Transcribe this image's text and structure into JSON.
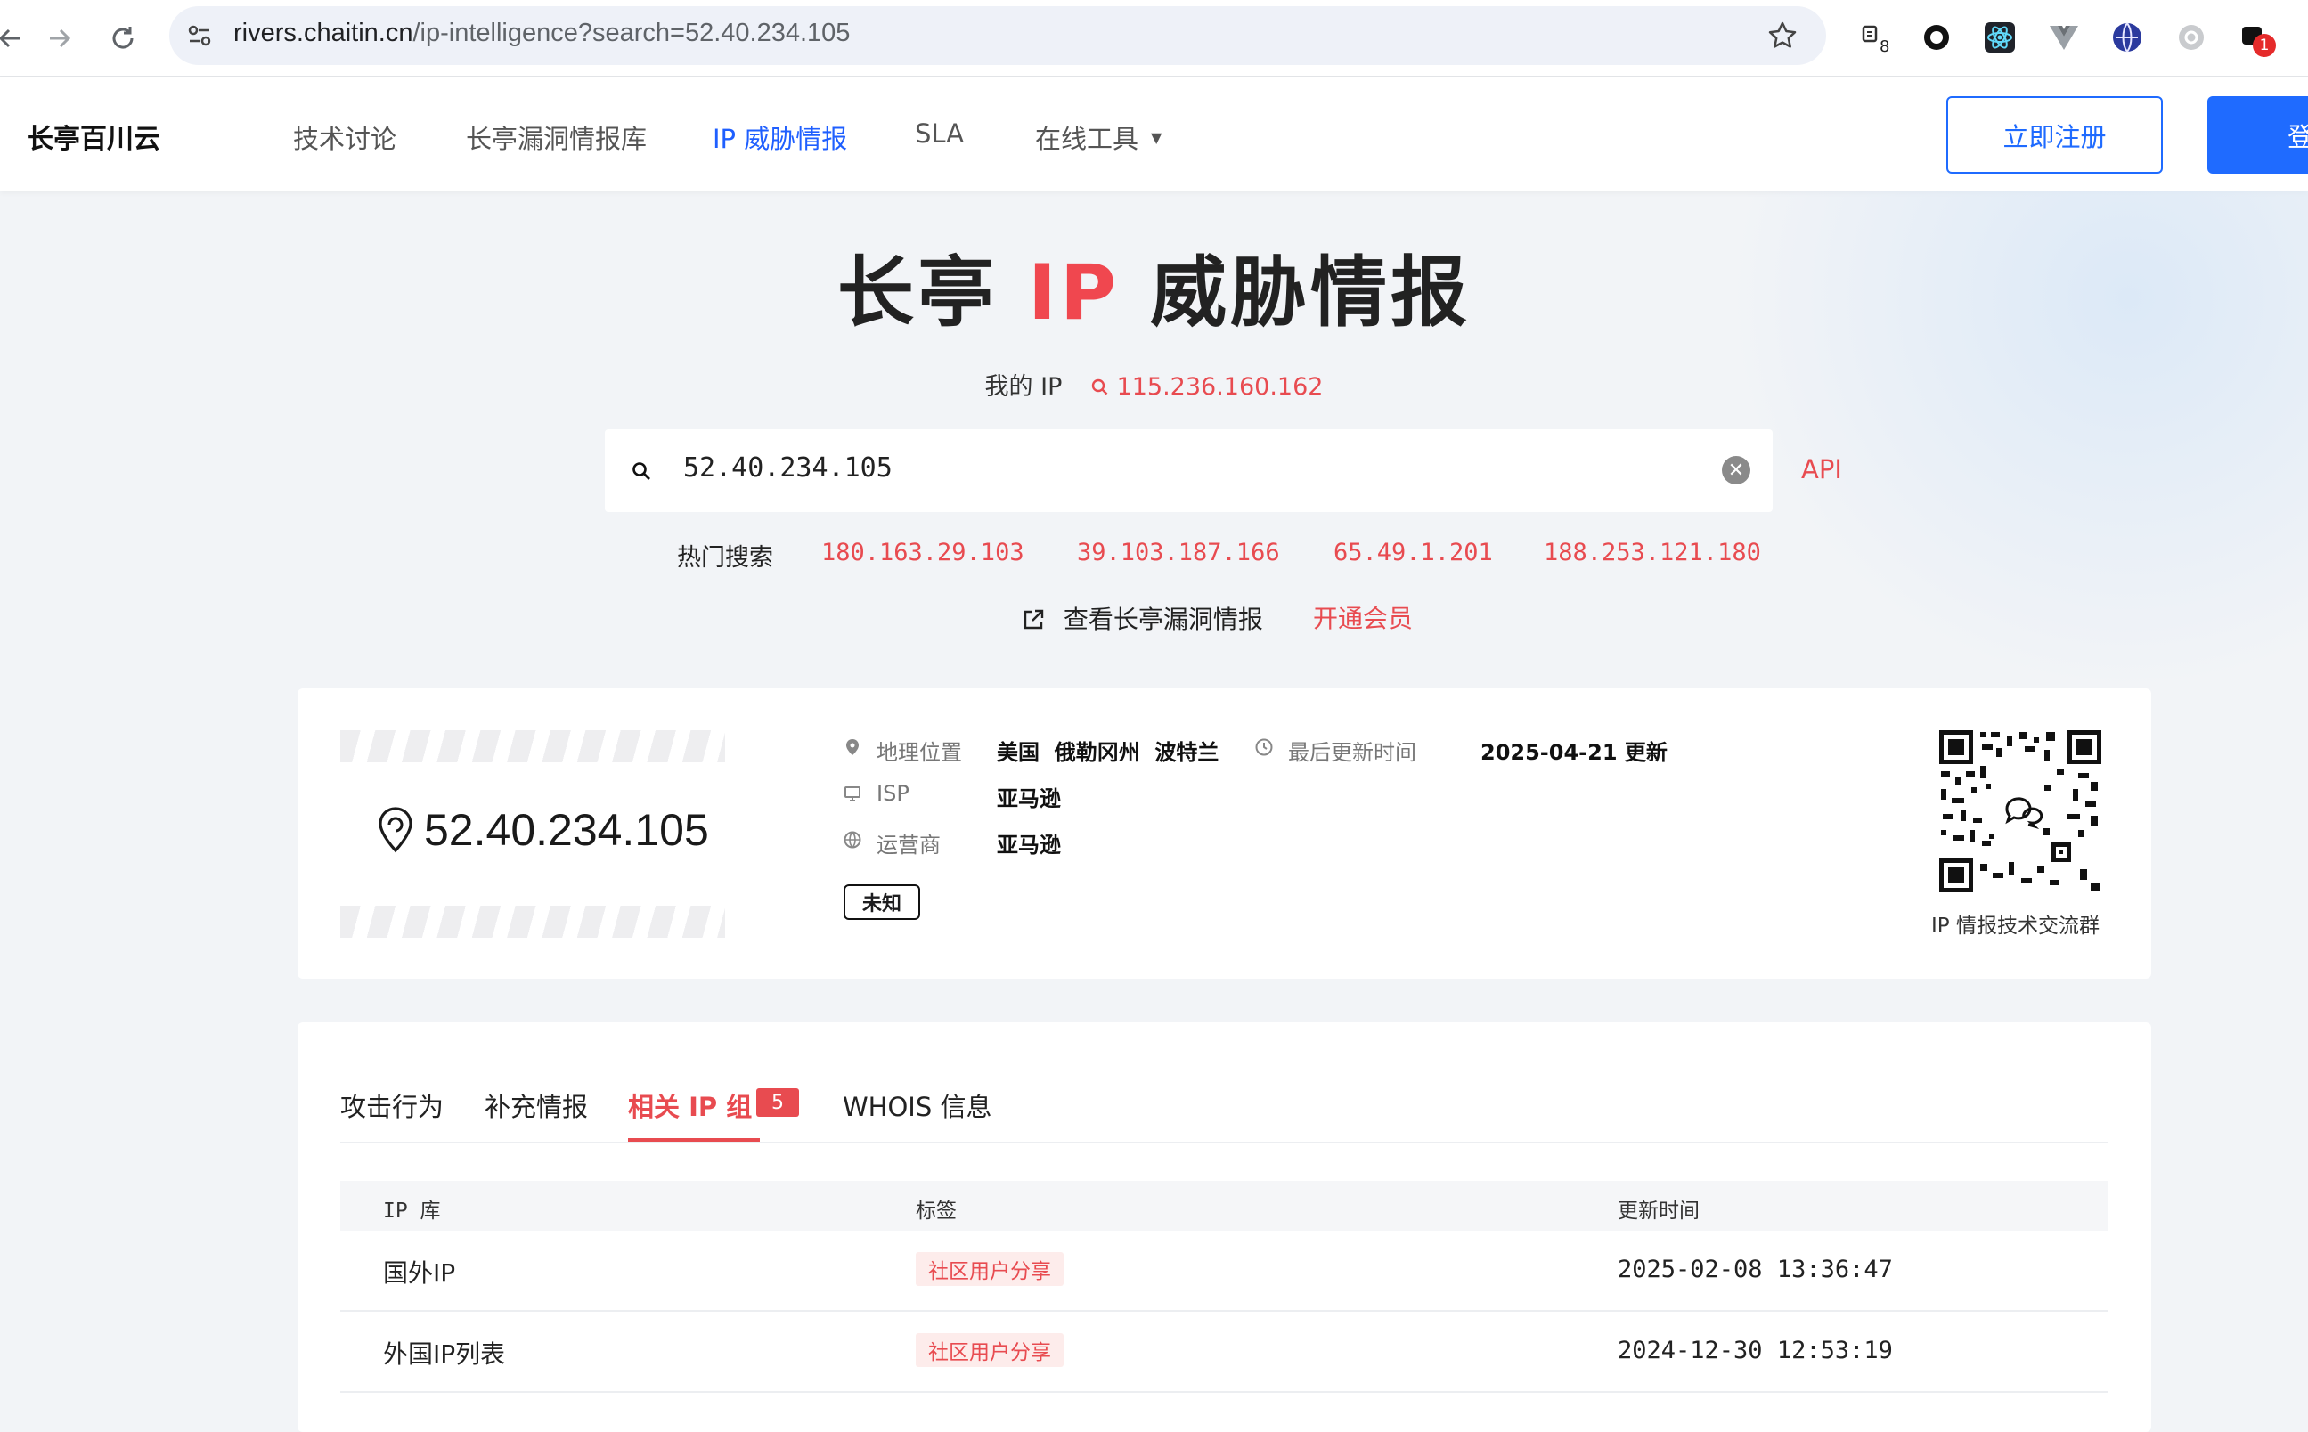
{
  "browser": {
    "url_host": "rivers.chaitin.cn",
    "url_path": "/ip-intelligence?search=52.40.234.105",
    "ext_badge_count": "8",
    "notif_badge_count": "1"
  },
  "header": {
    "logo": "长亭百川云",
    "nav": [
      {
        "label": "技术讨论"
      },
      {
        "label": "长亭漏洞情报库"
      },
      {
        "label": "IP 威胁情报"
      },
      {
        "label": "SLA"
      },
      {
        "label": "在线工具"
      }
    ],
    "register_label": "立即注册",
    "login_label": "登"
  },
  "hero": {
    "title_pre": "长亭",
    "title_ip": "IP",
    "title_post": "威胁情报",
    "myip_label": "我的 IP",
    "myip_value": "115.236.160.162",
    "search_value": "52.40.234.105",
    "api_label": "API",
    "hot_label": "热门搜索",
    "hot_ips": [
      "180.163.29.103",
      "39.103.187.166",
      "65.49.1.201",
      "188.253.121.180"
    ],
    "vuln_link": "查看长亭漏洞情报",
    "member_link": "开通会员"
  },
  "info": {
    "ip": "52.40.234.105",
    "geo_label": "地理位置",
    "geo_value": "美国  俄勒冈州  波特兰",
    "isp_label": "ISP",
    "isp_value": "亚马逊",
    "carrier_label": "运营商",
    "carrier_value": "亚马逊",
    "updated_label": "最后更新时间",
    "updated_value": "2025-04-21 更新",
    "tag": "未知",
    "qr_caption": "IP 情报技术交流群"
  },
  "tabs": {
    "items": [
      {
        "label": "攻击行为"
      },
      {
        "label": "补充情报"
      },
      {
        "label": "相关 IP 组"
      },
      {
        "label": "WHOIS 信息"
      }
    ],
    "active_badge": "5",
    "table": {
      "columns": [
        "IP 库",
        "标签",
        "更新时间"
      ],
      "rows": [
        {
          "name": "国外IP",
          "tag": "社区用户分享",
          "time": "2025-02-08 13:36:47"
        },
        {
          "name": "外国IP列表",
          "tag": "社区用户分享",
          "time": "2024-12-30 12:53:19"
        }
      ]
    }
  }
}
